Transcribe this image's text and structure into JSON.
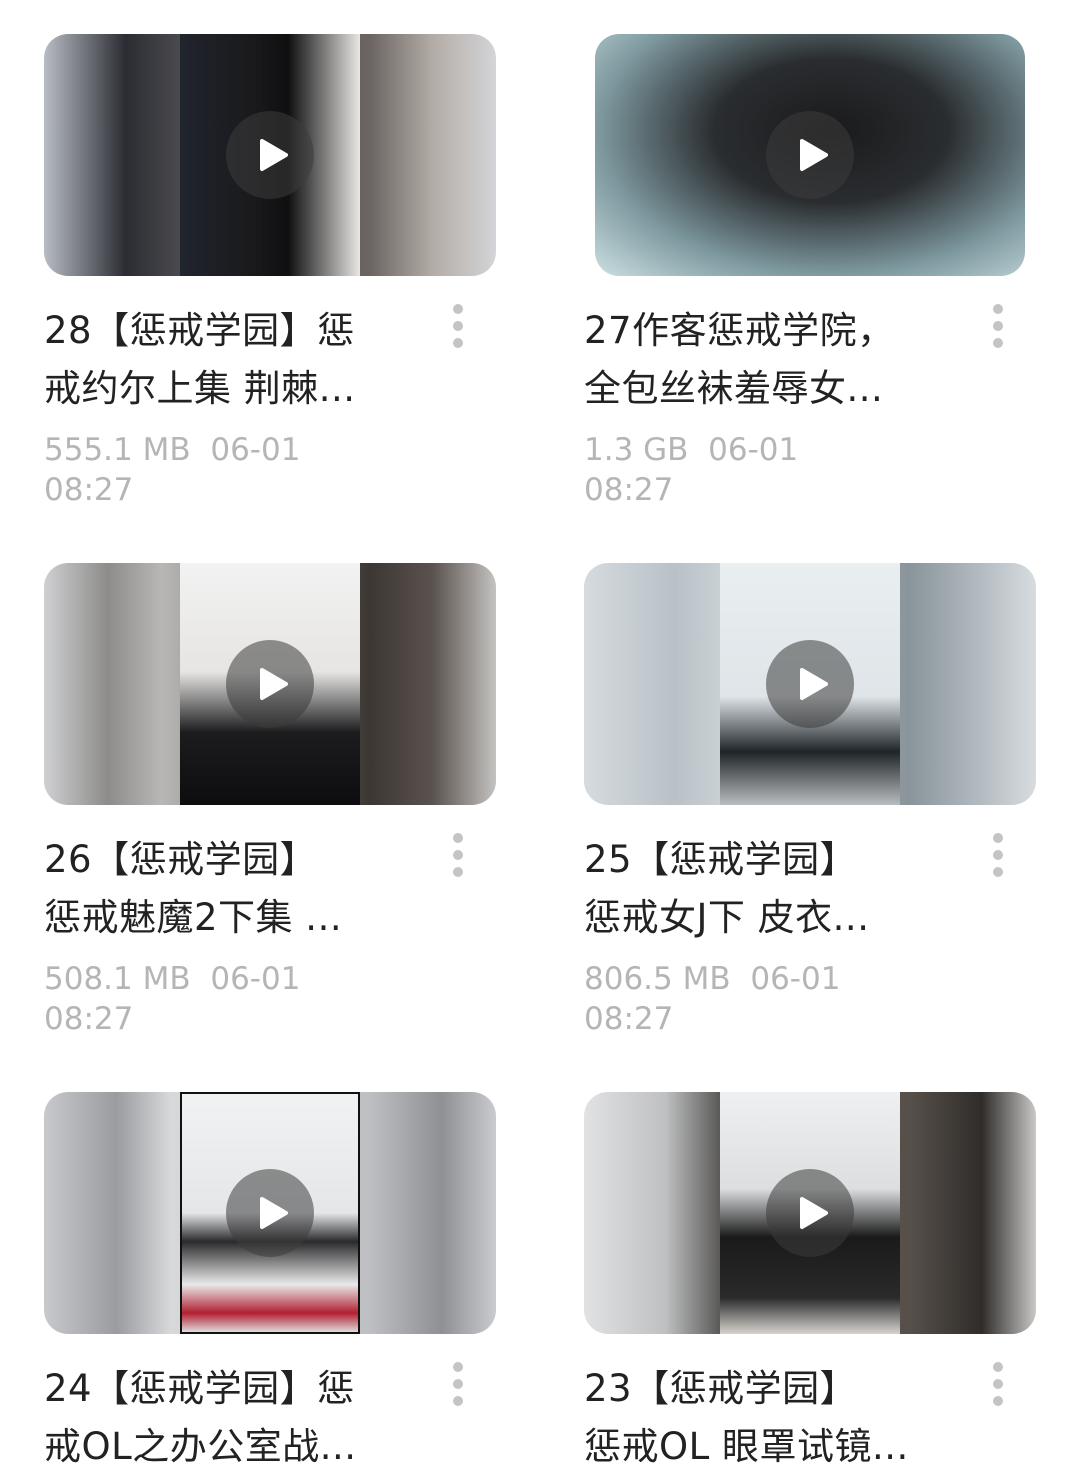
{
  "items": [
    {
      "title_line1": "28【惩戒学园】惩",
      "title_line2": "戒约尔上集 荆棘...",
      "size": "555.1 MB",
      "date": "06-01",
      "time": "08:27"
    },
    {
      "title_line1": "27作客惩戒学院，",
      "title_line2": "全包丝袜羞辱女...",
      "size": "1.3 GB",
      "date": "06-01",
      "time": "08:27"
    },
    {
      "title_line1": "26【惩戒学园】",
      "title_line2": "惩戒魅魔2下集 ...",
      "size": "508.1 MB",
      "date": "06-01",
      "time": "08:27"
    },
    {
      "title_line1": "25【惩戒学园】",
      "title_line2": "惩戒女J下 皮衣...",
      "size": "806.5 MB",
      "date": "06-01",
      "time": "08:27"
    },
    {
      "title_line1": "24【惩戒学园】惩",
      "title_line2": "戒OL之办公室战...",
      "size": "",
      "date": "",
      "time": ""
    },
    {
      "title_line1": "23【惩戒学园】",
      "title_line2": "惩戒OL 眼罩试镜...",
      "size": "",
      "date": "",
      "time": ""
    }
  ],
  "icons": {
    "play": "play-icon",
    "more": "more-vertical-icon"
  },
  "colors": {
    "title": "#222222",
    "meta": "#b5b5b5",
    "background": "#ffffff"
  }
}
